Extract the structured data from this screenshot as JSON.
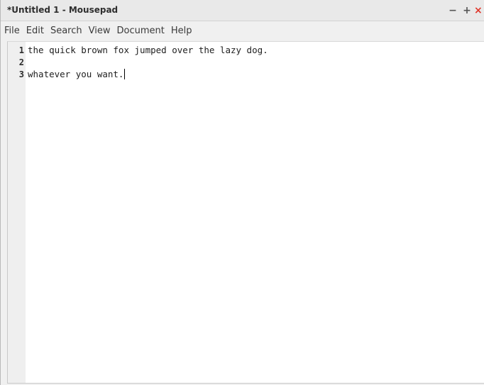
{
  "window": {
    "title": "*Untitled 1 - Mousepad",
    "controls": {
      "minimize": "−",
      "maximize": "+",
      "close": "×"
    }
  },
  "menubar": {
    "items": [
      "File",
      "Edit",
      "Search",
      "View",
      "Document",
      "Help"
    ]
  },
  "editor": {
    "line_numbers": [
      "1",
      "2",
      "3"
    ],
    "lines": [
      "the quick brown fox jumped over the lazy dog.",
      "",
      "whatever you want."
    ]
  },
  "colors": {
    "close_button": "#e0362a",
    "gutter_bg": "#efefef",
    "editor_bg": "#ffffff"
  },
  "icons": [
    "minimize-icon",
    "maximize-icon",
    "close-icon",
    "text-caret"
  ]
}
